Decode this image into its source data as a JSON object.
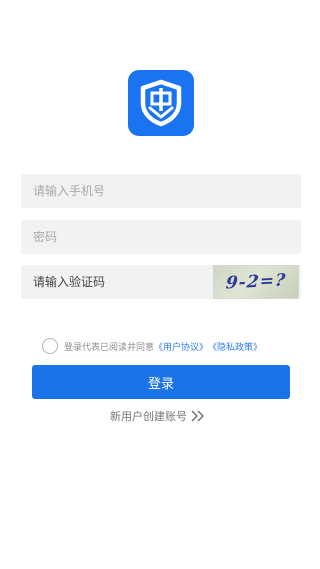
{
  "logo": {
    "icon": "shield-logo-icon",
    "color": "#1a73f0"
  },
  "form": {
    "phone_placeholder": "请输入手机号",
    "password_placeholder": "密码",
    "captcha_placeholder": "请输入验证码",
    "captcha_text": "9-2=?"
  },
  "agreement": {
    "prefix": "登录代表已阅读并同意",
    "user_agreement": "《用户协议》",
    "privacy_policy": "《隐私政策》",
    "checked": false
  },
  "login_button": "登录",
  "register_link": "新用户创建账号",
  "colors": {
    "primary": "#1a73e8",
    "link": "#2b7bf2",
    "field_bg": "#f2f2f2"
  }
}
